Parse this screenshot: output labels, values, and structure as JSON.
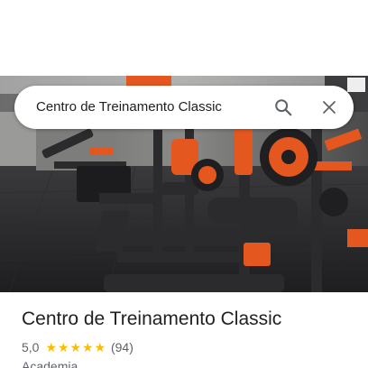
{
  "search": {
    "query": "Centro de Treinamento Classic"
  },
  "icons": {
    "search": "search-icon",
    "close": "close-icon"
  },
  "place": {
    "name": "Centro de Treinamento Classic",
    "rating": "5,0",
    "stars": 5,
    "review_count": "(94)",
    "category": "Academia"
  },
  "colors": {
    "star": "#fbbc04",
    "equipment_accent": "#e4571f"
  }
}
